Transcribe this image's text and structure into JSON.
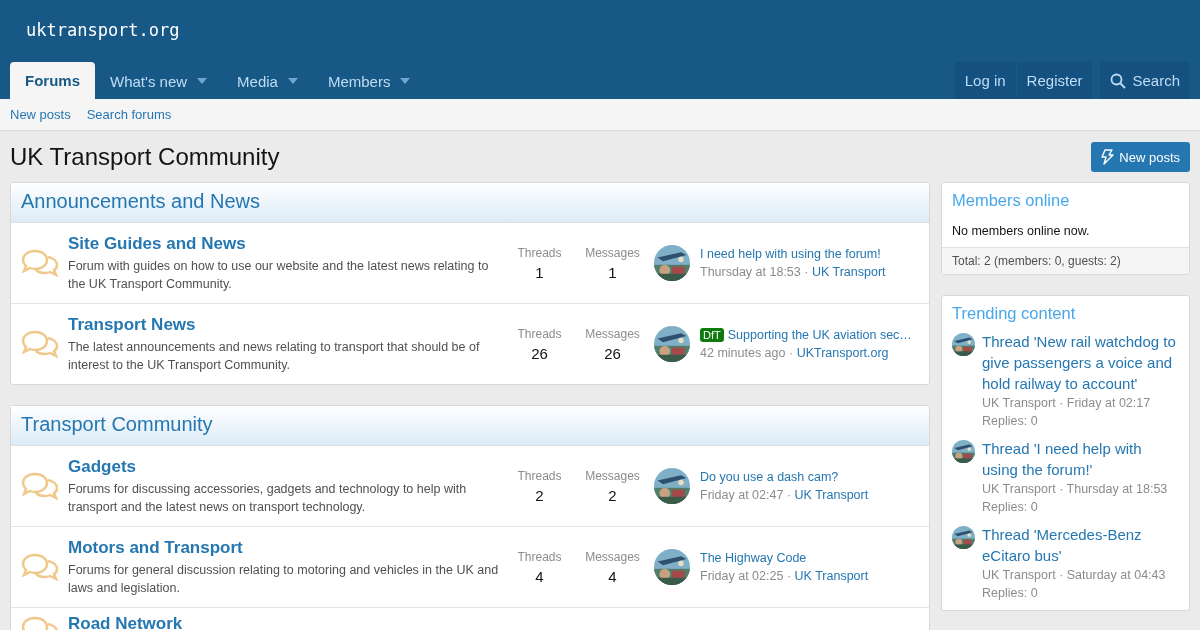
{
  "site": {
    "logo": "uktransport.org"
  },
  "nav": {
    "tabs": [
      {
        "label": "Forums",
        "selected": true,
        "dropdown": false
      },
      {
        "label": "What's new",
        "selected": false,
        "dropdown": true
      },
      {
        "label": "Media",
        "selected": false,
        "dropdown": true
      },
      {
        "label": "Members",
        "selected": false,
        "dropdown": true
      }
    ],
    "account": [
      "Log in",
      "Register"
    ],
    "search": "Search"
  },
  "subnav": [
    "New posts",
    "Search forums"
  ],
  "page": {
    "title": "UK Transport Community",
    "new_posts_button": "New posts"
  },
  "categories": [
    {
      "title": "Announcements and News",
      "forums": [
        {
          "title": "Site Guides and News",
          "description": "Forum with guides on how to use our website and the latest news relating to the UK Transport Community.",
          "threads_label": "Threads",
          "threads": "1",
          "messages_label": "Messages",
          "messages": "1",
          "last_post": {
            "title": "I need help with using the forum!",
            "time": "Thursday at 18:53",
            "separator": "·",
            "user": "UK Transport"
          }
        },
        {
          "title": "Transport News",
          "description": "The latest announcements and news relating to transport that should be of interest to the UK Transport Community.",
          "threads_label": "Threads",
          "threads": "26",
          "messages_label": "Messages",
          "messages": "26",
          "last_post": {
            "prefix": "DfT",
            "title": "Supporting the UK aviation sec…",
            "time": "42 minutes ago",
            "separator": "·",
            "user": "UKTransport.org"
          }
        }
      ]
    },
    {
      "title": "Transport Community",
      "forums": [
        {
          "title": "Gadgets",
          "description": "Forums for discussing accessories, gadgets and technology to help with transport and the latest news on transport technology.",
          "threads_label": "Threads",
          "threads": "2",
          "messages_label": "Messages",
          "messages": "2",
          "last_post": {
            "title": "Do you use a dash cam?",
            "time": "Friday at 02:47",
            "separator": "·",
            "user": "UK Transport"
          }
        },
        {
          "title": "Motors and Transport",
          "description": "Forums for general discussion relating to motoring and vehicles in the UK and laws and legislation.",
          "threads_label": "Threads",
          "threads": "4",
          "messages_label": "Messages",
          "messages": "4",
          "last_post": {
            "title": "The Highway Code",
            "time": "Friday at 02:25",
            "separator": "·",
            "user": "UK Transport"
          }
        },
        {
          "title": "Road Network"
        }
      ]
    }
  ],
  "sidebar": {
    "members_online": {
      "title": "Members online",
      "body": "No members online now.",
      "footer": "Total: 2 (members: 0, guests: 2)"
    },
    "trending": {
      "title": "Trending content",
      "items": [
        {
          "title": "Thread 'New rail watchdog to give passengers a voice and hold railway to account'",
          "user": "UK Transport",
          "separator": "·",
          "time": "Friday at 02:17",
          "replies": "Replies: 0"
        },
        {
          "title": "Thread 'I need help with using the forum!'",
          "user": "UK Transport",
          "separator": "·",
          "time": "Thursday at 18:53",
          "replies": "Replies: 0"
        },
        {
          "title": "Thread 'Mercedes-Benz eCitaro bus'",
          "user": "UK Transport",
          "separator": "·",
          "time": "Saturday at 04:43",
          "replies": "Replies: 0"
        }
      ]
    }
  }
}
